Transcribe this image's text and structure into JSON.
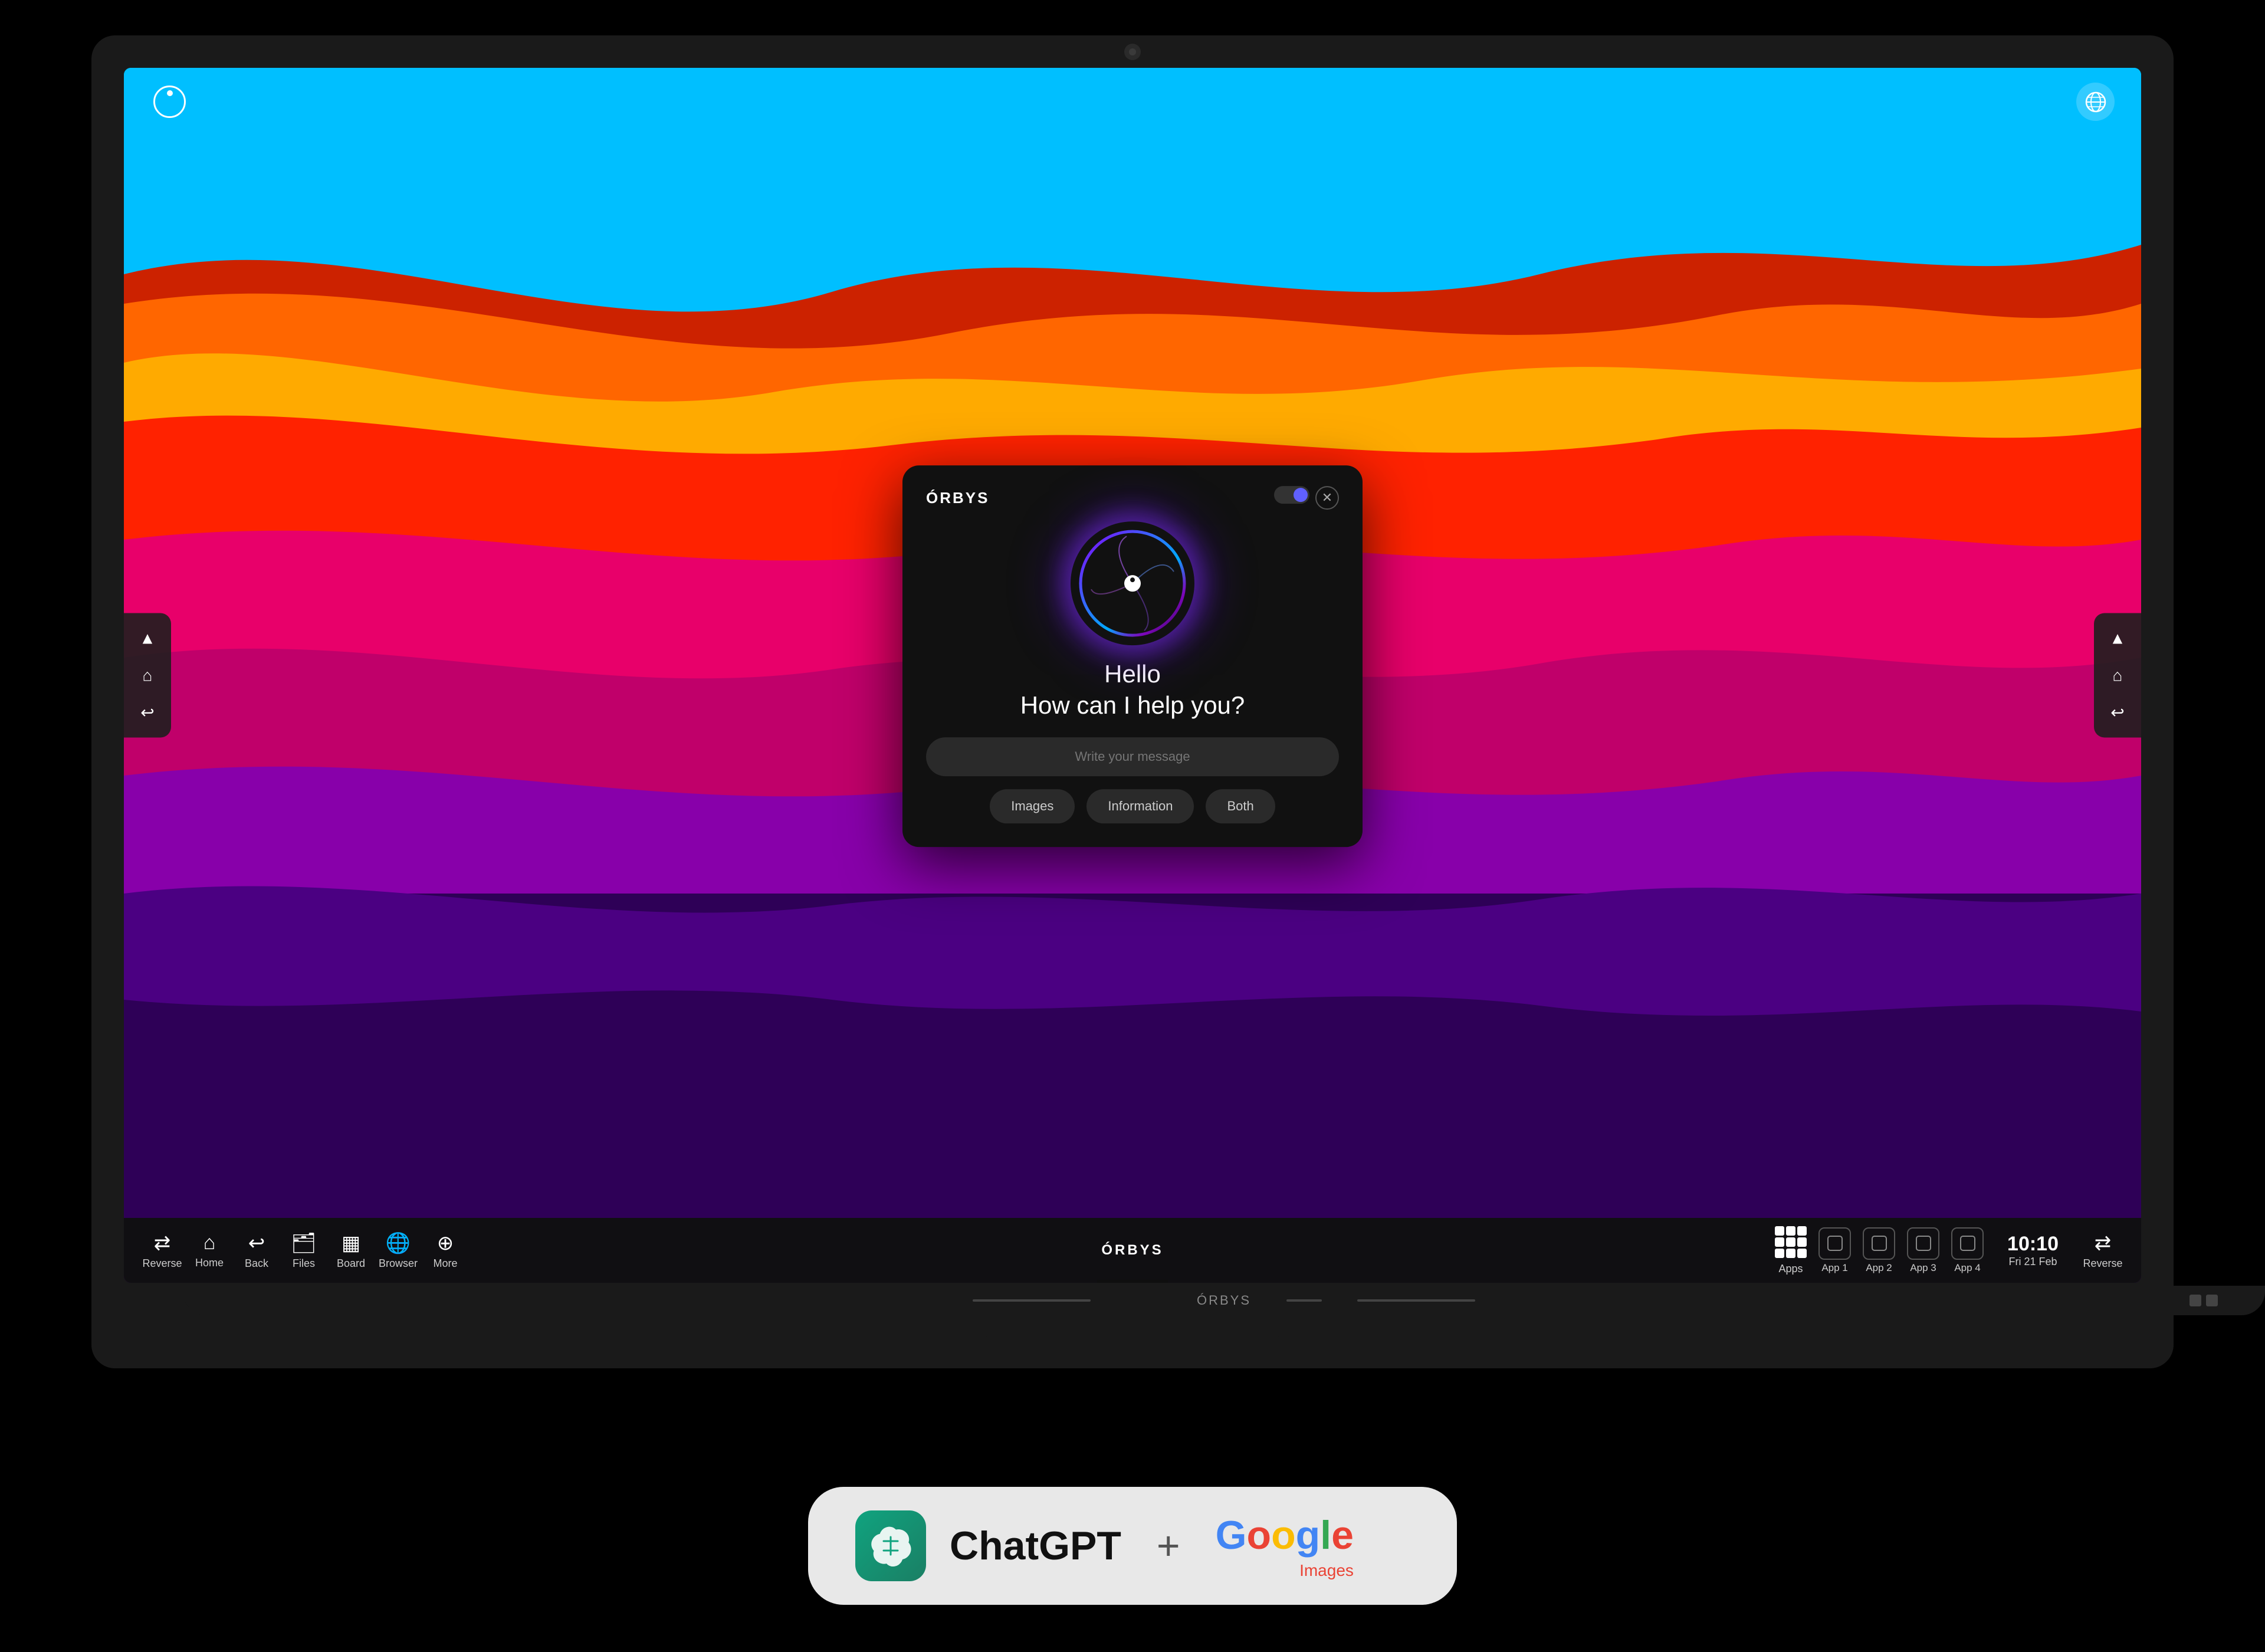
{
  "monitor": {
    "camera_label": "camera"
  },
  "logo": {
    "text": "ÓRBYS"
  },
  "dialog": {
    "title": "ÓRBYS",
    "greeting_hello": "Hello",
    "greeting_help": "How can I help you?",
    "input_placeholder": "Write your message",
    "btn_images": "Images",
    "btn_information": "Information",
    "btn_both": "Both"
  },
  "taskbar": {
    "center_logo": "ÓRBYS",
    "items_left": [
      {
        "icon": "⇄",
        "label": "Reverse"
      },
      {
        "icon": "⌂",
        "label": "Home"
      },
      {
        "icon": "↩",
        "label": "Back"
      },
      {
        "icon": "⬜",
        "label": "Files"
      },
      {
        "icon": "▦",
        "label": "Board"
      },
      {
        "icon": "⊕",
        "label": "Browser"
      },
      {
        "icon": "⊕",
        "label": "More"
      }
    ],
    "items_right": [
      {
        "icon": "apps",
        "label": "Apps"
      },
      {
        "label": "App 1"
      },
      {
        "label": "App 2"
      },
      {
        "label": "App 3"
      },
      {
        "label": "App 4"
      }
    ],
    "clock": {
      "time": "10:10",
      "date": "Fri 21 Feb"
    },
    "reverse_right": "⇄",
    "reverse_right_label": "Reverse"
  },
  "bottom_bar": {
    "logo": "ÓRBYS"
  },
  "bottom_card": {
    "chatgpt_label": "ChatGPT",
    "plus": "+",
    "google_label": "Google",
    "images_label": "Images"
  },
  "sidebar_left": {
    "btn_up": "▲",
    "btn_home": "⌂",
    "btn_back": "↩"
  },
  "sidebar_right": {
    "btn_up": "▲",
    "btn_home": "⌂",
    "btn_back": "↩"
  }
}
